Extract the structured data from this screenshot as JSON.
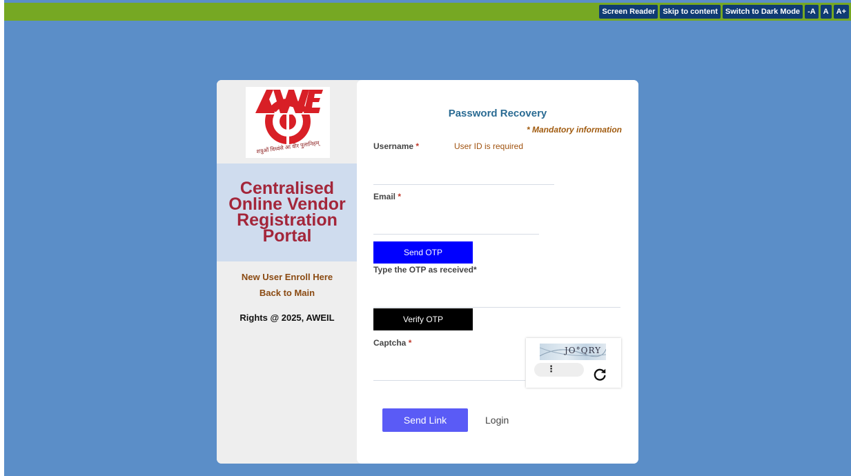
{
  "accessibility": {
    "screen_reader": "Screen Reader",
    "skip_to_content": "Skip to content",
    "dark_mode": "Switch to Dark Mode",
    "font_decrease": "-A",
    "font_reset": "A",
    "font_increase": "A+"
  },
  "sidebar": {
    "logo_text": "AWE",
    "logo_motto": "शत्रुओं विध्वंसे आ वीर पुलानिहम्",
    "portal_title": "Centralised Online Vendor Registration Portal",
    "enroll_link": "New User Enroll Here",
    "back_link": "Back to Main",
    "rights": "Rights @ 2025, AWEIL"
  },
  "form": {
    "title": "Password Recovery",
    "mandatory_note": "* Mandatory information",
    "username_label": "Username",
    "username_error": "User ID is required",
    "username_value": "",
    "email_label": "Email",
    "email_value": "",
    "send_otp": "Send OTP",
    "otp_label": "Type the OTP as received",
    "otp_value": "",
    "verify_otp": "Verify OTP",
    "captcha_label": "Captcha",
    "captcha_value": "",
    "captcha_text": "JO°QRY",
    "captcha_menu": "⋮",
    "send_link": "Send Link",
    "login_link": "Login"
  },
  "colors": {
    "topbar": "#76a823",
    "background": "#5b8ec8",
    "send_otp_bg": "#0000ff",
    "verify_otp_bg": "#000000",
    "send_link_bg": "#5a5bf6",
    "title_red": "#a3263a"
  }
}
